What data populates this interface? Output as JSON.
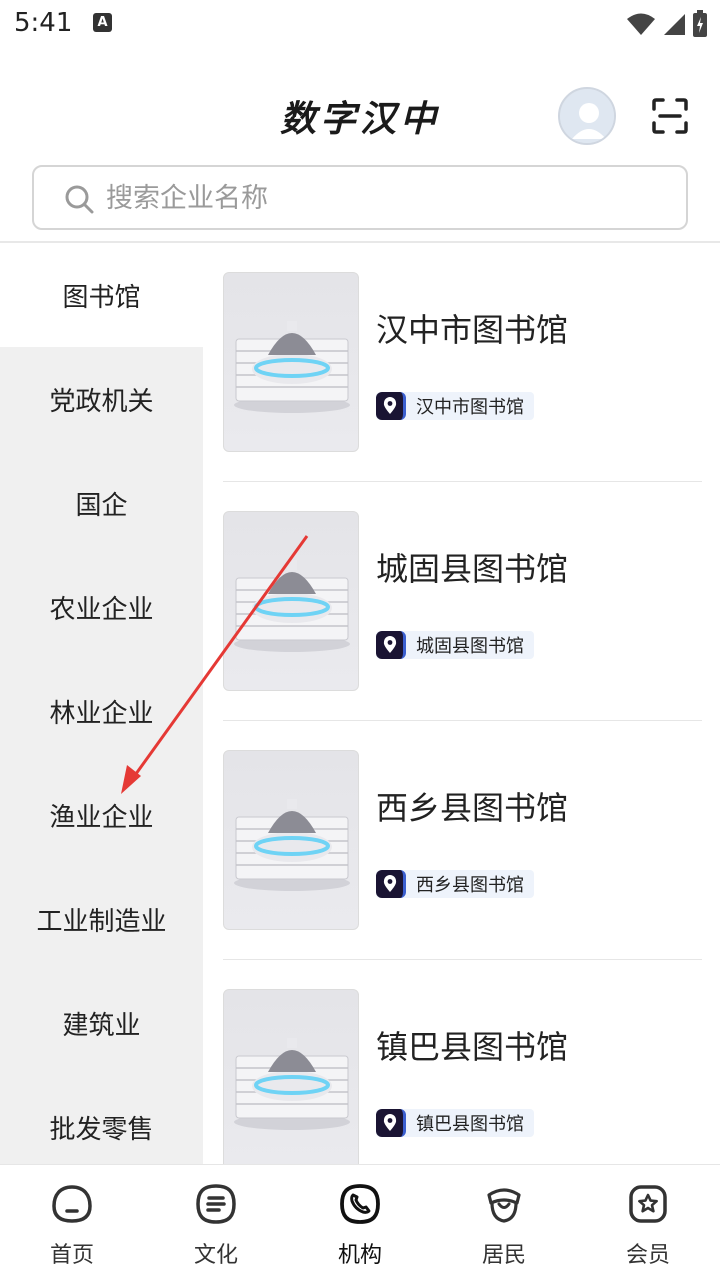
{
  "status_bar": {
    "time": "5:41",
    "notification_letter": "A"
  },
  "header": {
    "title": "数字汉中"
  },
  "search": {
    "placeholder": "搜索企业名称",
    "value": ""
  },
  "sidebar": {
    "items": [
      {
        "label": "图书馆",
        "active": true
      },
      {
        "label": "党政机关"
      },
      {
        "label": "国企"
      },
      {
        "label": "农业企业"
      },
      {
        "label": "林业企业"
      },
      {
        "label": "渔业企业"
      },
      {
        "label": "工业制造业"
      },
      {
        "label": "建筑业"
      },
      {
        "label": "批发零售"
      }
    ]
  },
  "list": {
    "items": [
      {
        "title": "汉中市图书馆",
        "location": "汉中市图书馆"
      },
      {
        "title": "城固县图书馆",
        "location": "城固县图书馆"
      },
      {
        "title": "西乡县图书馆",
        "location": "西乡县图书馆"
      },
      {
        "title": "镇巴县图书馆",
        "location": "镇巴县图书馆"
      }
    ]
  },
  "bottom_nav": {
    "items": [
      {
        "label": "首页",
        "icon": "home-icon"
      },
      {
        "label": "文化",
        "icon": "culture-icon"
      },
      {
        "label": "机构",
        "icon": "institution-icon",
        "active": true
      },
      {
        "label": "居民",
        "icon": "resident-icon"
      },
      {
        "label": "会员",
        "icon": "member-icon"
      }
    ]
  },
  "colors": {
    "sidebar_bg": "#f0f0f0",
    "annotation_arrow": "#e53935",
    "tag_bg": "#eef3fb",
    "pin_bg": "#1a1433"
  }
}
